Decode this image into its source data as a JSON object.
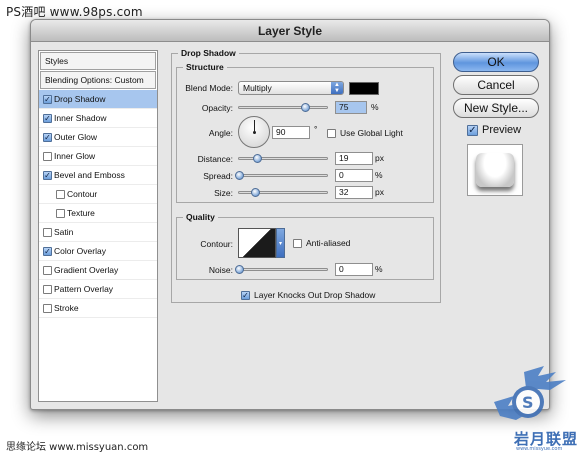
{
  "watermark": {
    "top": "PS酒吧 www.98ps.com",
    "bottom": "思缘论坛 www.missyuan.com",
    "logo_text": "岩月联盟",
    "logo_url": "www.missyue.com"
  },
  "window": {
    "title": "Layer Style"
  },
  "styles_panel": {
    "header": "Styles",
    "items": [
      {
        "label": "Blending Options: Custom",
        "type": "header"
      },
      {
        "label": "Drop Shadow",
        "checked": true,
        "selected": true
      },
      {
        "label": "Inner Shadow",
        "checked": true
      },
      {
        "label": "Outer Glow",
        "checked": true
      },
      {
        "label": "Inner Glow",
        "checked": false
      },
      {
        "label": "Bevel and Emboss",
        "checked": true
      },
      {
        "label": "Contour",
        "checked": false,
        "sub": true
      },
      {
        "label": "Texture",
        "checked": false,
        "sub": true
      },
      {
        "label": "Satin",
        "checked": false
      },
      {
        "label": "Color Overlay",
        "checked": true
      },
      {
        "label": "Gradient Overlay",
        "checked": false
      },
      {
        "label": "Pattern Overlay",
        "checked": false
      },
      {
        "label": "Stroke",
        "checked": false
      }
    ]
  },
  "drop_shadow": {
    "title": "Drop Shadow",
    "structure": {
      "title": "Structure",
      "blend_mode_label": "Blend Mode:",
      "blend_mode_value": "Multiply",
      "shadow_color": "#000000",
      "opacity_label": "Opacity:",
      "opacity_value": "75",
      "opacity_unit": "%",
      "angle_label": "Angle:",
      "angle_value": "90",
      "angle_unit": "°",
      "use_global_light_label": "Use Global Light",
      "use_global_light_checked": false,
      "distance_label": "Distance:",
      "distance_value": "19",
      "distance_unit": "px",
      "spread_label": "Spread:",
      "spread_value": "0",
      "spread_unit": "%",
      "size_label": "Size:",
      "size_value": "32",
      "size_unit": "px"
    },
    "quality": {
      "title": "Quality",
      "contour_label": "Contour:",
      "anti_aliased_label": "Anti-aliased",
      "anti_aliased_checked": false,
      "noise_label": "Noise:",
      "noise_value": "0",
      "noise_unit": "%"
    },
    "knockout_label": "Layer Knocks Out Drop Shadow",
    "knockout_checked": true
  },
  "buttons": {
    "ok": "OK",
    "cancel": "Cancel",
    "new_style": "New Style...",
    "preview_label": "Preview",
    "preview_checked": true
  }
}
